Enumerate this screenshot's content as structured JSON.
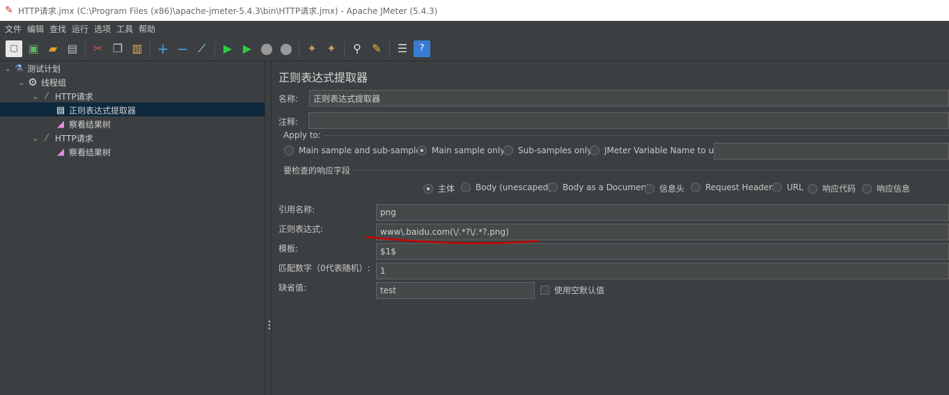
{
  "window": {
    "title": "HTTP请求.jmx (C:\\Program Files (x86)\\apache-jmeter-5.4.3\\bin\\HTTP请求.jmx) - Apache JMeter (5.4.3)"
  },
  "menu": [
    "文件",
    "编辑",
    "查找",
    "运行",
    "选项",
    "工具",
    "帮助"
  ],
  "toolbar": {
    "icons": [
      "new-icon",
      "templates-icon",
      "open-icon",
      "save-icon",
      "cut-icon",
      "copy-icon",
      "paste-icon",
      "expand-icon",
      "collapse-icon",
      "toggle-icon",
      "start-icon",
      "start-no-pause-icon",
      "stop-icon",
      "shutdown-icon",
      "clear-icon",
      "clear-all-icon",
      "search-icon",
      "reset-search-icon",
      "function-helper-icon",
      "help-icon"
    ]
  },
  "tree": {
    "items": [
      {
        "label": "测试计划",
        "icon": "flask-icon",
        "level": 0,
        "expanded": true
      },
      {
        "label": "线程组",
        "icon": "gear-icon",
        "level": 1,
        "expanded": true
      },
      {
        "label": "HTTP请求",
        "icon": "pipette-icon",
        "level": 2,
        "expanded": true
      },
      {
        "label": "正则表达式提取器",
        "icon": "document-icon",
        "level": 3,
        "selected": true
      },
      {
        "label": "察看结果树",
        "icon": "chart-icon",
        "level": 3
      },
      {
        "label": "HTTP请求",
        "icon": "pipette-icon",
        "level": 2,
        "expanded": true
      },
      {
        "label": "察看结果树",
        "icon": "chart-icon",
        "level": 3
      }
    ]
  },
  "panel": {
    "title": "正则表达式提取器",
    "name_label": "名称:",
    "name_value": "正则表达式提取器",
    "comment_label": "注释:",
    "comment_value": "",
    "apply_to": {
      "legend": "Apply to:",
      "options": [
        {
          "label": "Main sample and sub-samples",
          "selected": false
        },
        {
          "label": "Main sample only",
          "selected": true
        },
        {
          "label": "Sub-samples only",
          "selected": false
        },
        {
          "label": "JMeter Variable Name to use",
          "selected": false
        }
      ],
      "variable_value": ""
    },
    "field_to_check": {
      "legend": "要检查的响应字段",
      "options": [
        {
          "label": "主体",
          "selected": true
        },
        {
          "label": "Body (unescaped)",
          "selected": false
        },
        {
          "label": "Body as a Document",
          "selected": false
        },
        {
          "label": "信息头",
          "selected": false
        },
        {
          "label": "Request Headers",
          "selected": false
        },
        {
          "label": "URL",
          "selected": false
        },
        {
          "label": "响应代码",
          "selected": false
        },
        {
          "label": "响应信息",
          "selected": false
        }
      ]
    },
    "ref_name_label": "引用名称:",
    "ref_name_value": "png",
    "regex_label": "正则表达式:",
    "regex_value": "www\\.baidu.com(\\/.*?\\/.*?.png)",
    "template_label": "模板:",
    "template_value": "$1$",
    "match_no_label": "匹配数字（0代表随机）:",
    "match_no_value": "1",
    "default_label": "缺省值:",
    "default_value": "test",
    "use_empty_default_label": "使用空默认值",
    "use_empty_default": false,
    "annotation_color": "#cc0000"
  }
}
